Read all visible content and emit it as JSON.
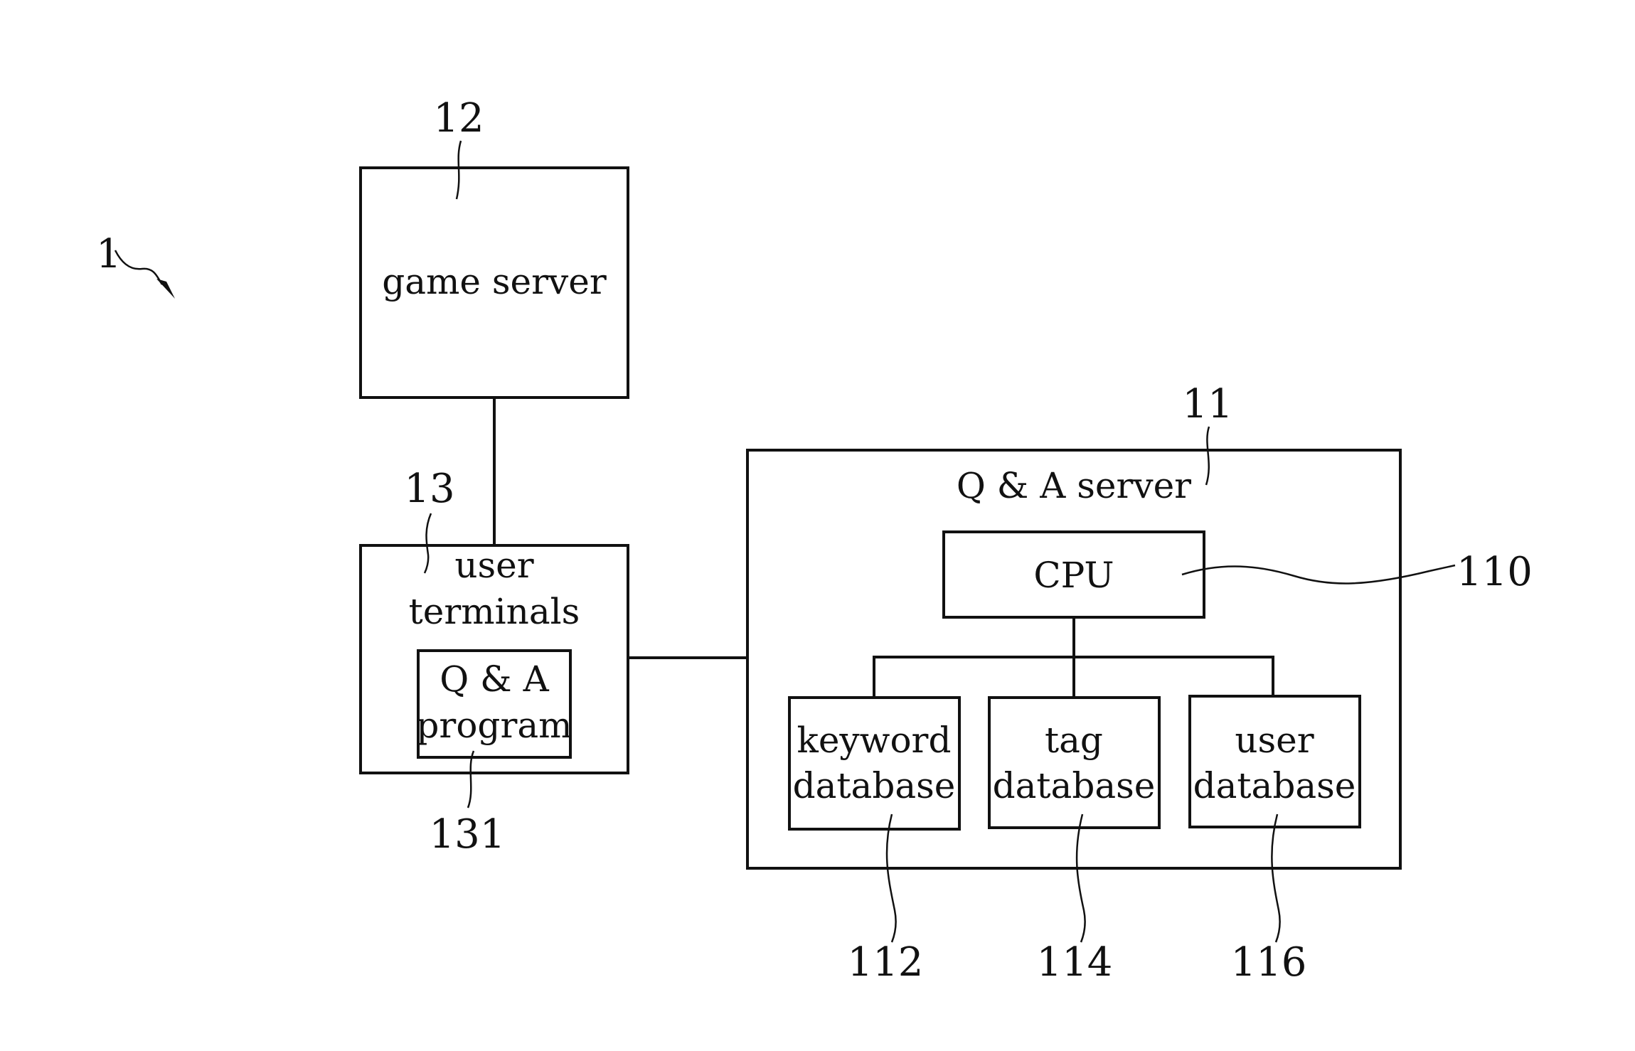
{
  "figure_label": "1",
  "nodes": {
    "game_server": {
      "ref": "12",
      "label": "game server"
    },
    "user_terminals": {
      "ref": "13",
      "label_lines": [
        "user",
        "terminals"
      ]
    },
    "qa_program": {
      "ref": "131",
      "label_lines": [
        "Q & A",
        "program"
      ]
    },
    "qa_server": {
      "ref": "11",
      "label": "Q & A server"
    },
    "cpu": {
      "ref": "110",
      "label": "CPU"
    },
    "keyword_db": {
      "ref": "112",
      "label_lines": [
        "keyword",
        "database"
      ]
    },
    "tag_db": {
      "ref": "114",
      "label_lines": [
        "tag",
        "database"
      ]
    },
    "user_db": {
      "ref": "116",
      "label_lines": [
        "user",
        "database"
      ]
    }
  },
  "edges": [
    [
      "game_server",
      "user_terminals"
    ],
    [
      "user_terminals",
      "qa_server"
    ],
    [
      "cpu",
      "keyword_db"
    ],
    [
      "cpu",
      "tag_db"
    ],
    [
      "cpu",
      "user_db"
    ]
  ]
}
